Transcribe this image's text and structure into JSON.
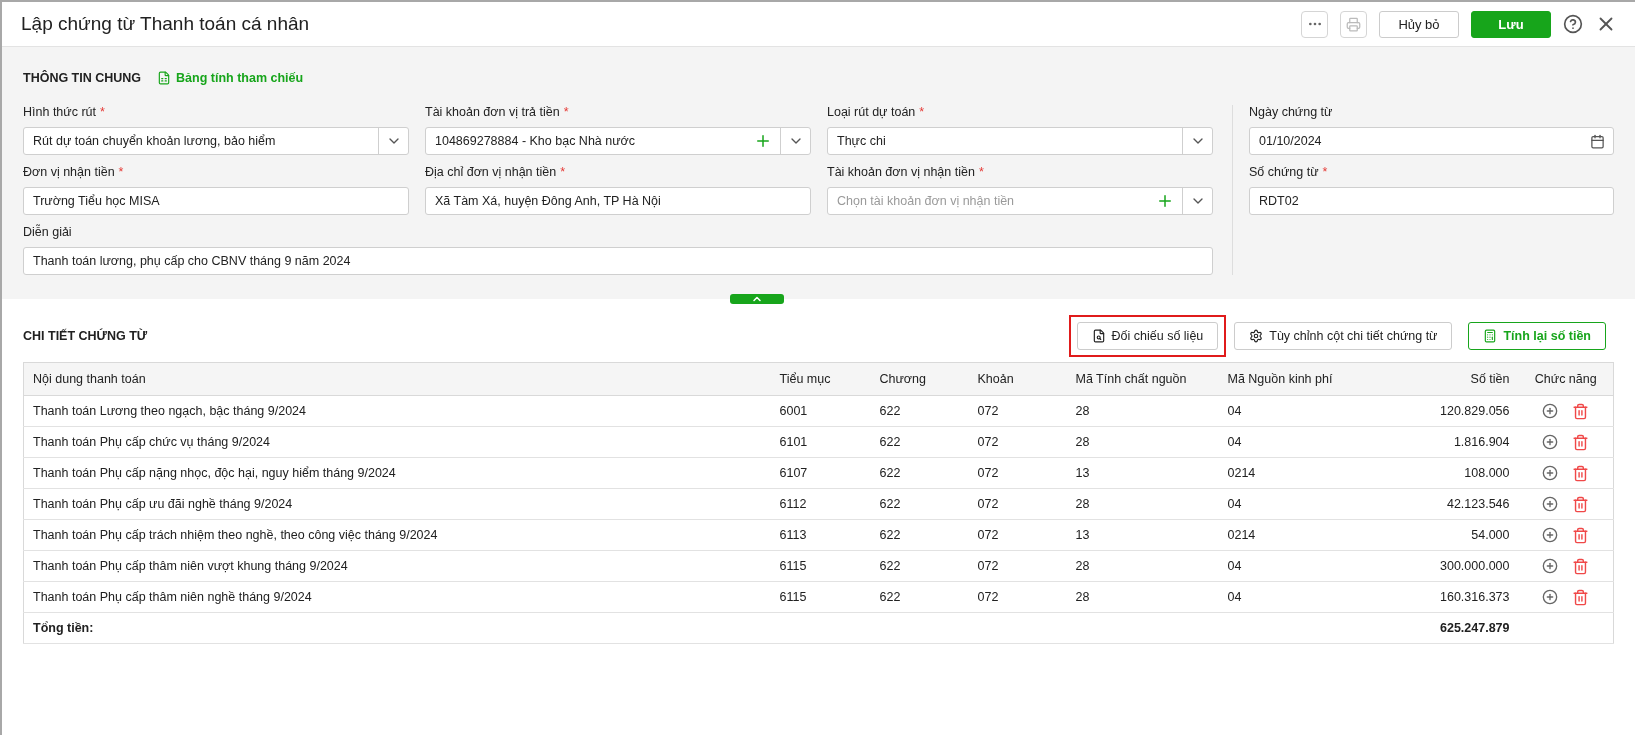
{
  "window": {
    "title": "Lập chứng từ Thanh toán cá nhân",
    "buttons": [
      {
        "kind": "more"
      },
      {
        "kind": "print",
        "disabled": true
      },
      {
        "kind": "secondary",
        "label": "Hủy bỏ"
      },
      {
        "kind": "primary",
        "label": "Lưu"
      },
      {
        "kind": "help"
      },
      {
        "kind": "close"
      }
    ]
  },
  "general": {
    "title": "THÔNG TIN CHUNG",
    "link": "Bảng tính tham chiếu",
    "fields": [
      {
        "label": "Hình thức rút",
        "mark": "*",
        "kind": "select",
        "value": "Rút dự toán chuyển khoản lương, bảo hiểm"
      },
      {
        "label": "Tài khoản đơn vị trả tiền",
        "mark": "*",
        "kind": "select_add",
        "value": "104869278884 - Kho bạc Nhà nước"
      },
      {
        "label": "Loại rút dự toán",
        "mark": "*",
        "kind": "select",
        "value": "Thực chi"
      },
      {
        "label": "Đơn vị nhận tiền",
        "mark": "*",
        "kind": "text",
        "value": "Trường Tiểu học MISA"
      },
      {
        "label": "Địa chỉ đơn vị nhận tiền",
        "mark": "*",
        "kind": "text",
        "value": "Xã Tàm Xá, huyện Đông Anh, TP Hà Nội"
      },
      {
        "label": "Tài khoản đơn vị nhận tiền",
        "mark": "*",
        "kind": "select_add",
        "placeholder": "Chọn tài khoản đơn vị nhận tiền"
      },
      {
        "label": "Diễn giải",
        "kind": "text",
        "value": "Thanh toán lương, phụ cấp cho CBNV tháng 9 năm 2024"
      }
    ],
    "side_fields": [
      {
        "label": "Ngày chứng từ",
        "kind": "date",
        "value": "01/10/2024"
      },
      {
        "label": "Số chứng từ",
        "mark": "*",
        "kind": "text",
        "value": "RDT02"
      }
    ]
  },
  "detail": {
    "title": "CHI TIẾT CHỨNG TỪ",
    "buttons": [
      {
        "kind": "compare",
        "label": "Đối chiếu số liệu",
        "highlighted": true
      },
      {
        "kind": "settings",
        "label": "Tùy chỉnh cột chi tiết chứng từ",
        "highlighted": false
      },
      {
        "kind": "calc",
        "label": "Tính lại số tiền",
        "highlighted": false
      }
    ],
    "columns": [
      "Nội dung thanh toán",
      "Tiểu mục",
      "Chương",
      "Khoản",
      "Mã Tính chất nguồn",
      "Mã Nguồn kinh phí",
      "Số tiền",
      "Chức năng"
    ],
    "rows": [
      [
        "Thanh toán Lương theo ngạch, bậc tháng 9/2024",
        "6001",
        "622",
        "072",
        "28",
        "04",
        "120.829.056"
      ],
      [
        "Thanh toán Phụ cấp chức vụ tháng 9/2024",
        "6101",
        "622",
        "072",
        "28",
        "04",
        "1.816.904"
      ],
      [
        "Thanh toán Phụ cấp nặng nhọc, độc hại, nguy hiểm tháng 9/2024",
        "6107",
        "622",
        "072",
        "13",
        "0214",
        "108.000"
      ],
      [
        "Thanh toán Phụ cấp ưu đãi nghề tháng 9/2024",
        "6112",
        "622",
        "072",
        "28",
        "04",
        "42.123.546"
      ],
      [
        "Thanh toán Phụ cấp trách nhiệm theo nghề, theo công việc tháng 9/2024",
        "6113",
        "622",
        "072",
        "13",
        "0214",
        "54.000"
      ],
      [
        "Thanh toán Phụ cấp thâm niên vượt khung tháng 9/2024",
        "6115",
        "622",
        "072",
        "28",
        "04",
        "300.000.000"
      ],
      [
        "Thanh toán Phụ cấp thâm niên nghề tháng 9/2024",
        "6115",
        "622",
        "072",
        "28",
        "04",
        "160.316.373"
      ]
    ],
    "total": {
      "label": "Tổng tiền:",
      "value": "625.247.879"
    }
  }
}
